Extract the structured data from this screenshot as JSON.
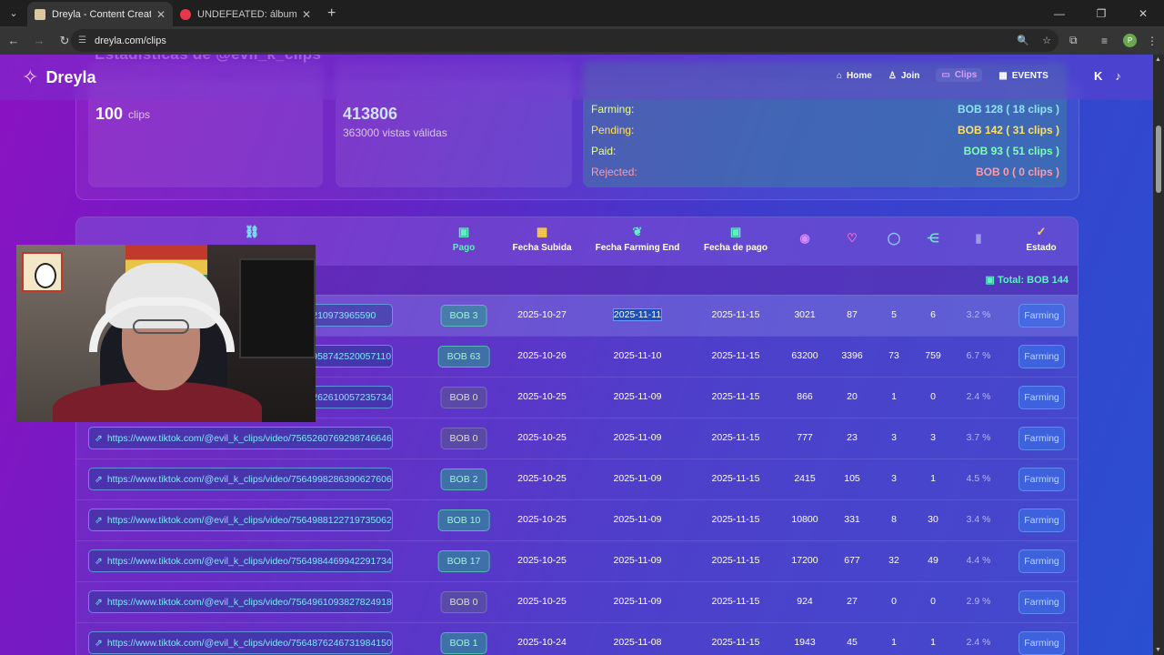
{
  "browser": {
    "tabs": [
      {
        "title": "Dreyla - Content Creator & Stre",
        "active": true
      },
      {
        "title": "UNDEFEATED: álbum de XG",
        "active": false
      }
    ],
    "url": "dreyla.com/clips",
    "profile_initial": "P"
  },
  "site": {
    "brand": "Dreyla",
    "ghost_title": "Estadísticas de @evil_k_clips",
    "nav": [
      "Home",
      "Join",
      "Clips",
      "EVENTS"
    ],
    "current": "Clips"
  },
  "stats": {
    "clips_value": "100",
    "clips_unit": "clips",
    "views_value": "413806",
    "views_sub": "363000 vistas válidas",
    "payments": [
      {
        "label": "Farming:",
        "value": "BOB 128 ( 18 clips )",
        "color": "#8fe3ff"
      },
      {
        "label": "Pending:",
        "value": "BOB 142 ( 31 clips )",
        "color": "#ffe066"
      },
      {
        "label": "Paid:",
        "value": "BOB 93 ( 51 clips )",
        "color": "#7dffb5"
      },
      {
        "label": "Rejected:",
        "value": "BOB 0 ( 0 clips )",
        "color": "#ff9aa8"
      }
    ]
  },
  "table": {
    "headers": {
      "pago": "Pago",
      "subida": "Fecha Subida",
      "farming_end": "Fecha Farming End",
      "fecha_pago": "Fecha de pago",
      "estado": "Estado"
    },
    "total": "Total: BOB 144",
    "rows": [
      {
        "link": "https://www.tiktok.com/@evil_k_clips/video/7565210973965590",
        "pago": "BOB 3",
        "paid": true,
        "subida": "2025-10-27",
        "fend": "2025-11-11",
        "fpago": "2025-11-15",
        "views": "3021",
        "likes": "87",
        "comments": "5",
        "shares": "6",
        "pct": "3.2 %",
        "estado": "Farming"
      },
      {
        "link": "https://www.tiktok.com/@evil_k_clips/video/7564958742520057110",
        "pago": "BOB 63",
        "paid": true,
        "subida": "2025-10-26",
        "fend": "2025-11-10",
        "fpago": "2025-11-15",
        "views": "63200",
        "likes": "3396",
        "comments": "73",
        "shares": "759",
        "pct": "6.7 %",
        "estado": "Farming"
      },
      {
        "link": "https://www.tiktok.com/@evil_k_clips/video/7565262610057235734",
        "pago": "BOB 0",
        "paid": false,
        "subida": "2025-10-25",
        "fend": "2025-11-09",
        "fpago": "2025-11-15",
        "views": "866",
        "likes": "20",
        "comments": "1",
        "shares": "0",
        "pct": "2.4 %",
        "estado": "Farming"
      },
      {
        "link": "https://www.tiktok.com/@evil_k_clips/video/7565260769298746646",
        "pago": "BOB 0",
        "paid": false,
        "subida": "2025-10-25",
        "fend": "2025-11-09",
        "fpago": "2025-11-15",
        "views": "777",
        "likes": "23",
        "comments": "3",
        "shares": "3",
        "pct": "3.7 %",
        "estado": "Farming"
      },
      {
        "link": "https://www.tiktok.com/@evil_k_clips/video/7564998286390627606",
        "pago": "BOB 2",
        "paid": true,
        "subida": "2025-10-25",
        "fend": "2025-11-09",
        "fpago": "2025-11-15",
        "views": "2415",
        "likes": "105",
        "comments": "3",
        "shares": "1",
        "pct": "4.5 %",
        "estado": "Farming"
      },
      {
        "link": "https://www.tiktok.com/@evil_k_clips/video/7564988122719735062",
        "pago": "BOB 10",
        "paid": true,
        "subida": "2025-10-25",
        "fend": "2025-11-09",
        "fpago": "2025-11-15",
        "views": "10800",
        "likes": "331",
        "comments": "8",
        "shares": "30",
        "pct": "3.4 %",
        "estado": "Farming"
      },
      {
        "link": "https://www.tiktok.com/@evil_k_clips/video/7564984469942291734",
        "pago": "BOB 17",
        "paid": true,
        "subida": "2025-10-25",
        "fend": "2025-11-09",
        "fpago": "2025-11-15",
        "views": "17200",
        "likes": "677",
        "comments": "32",
        "shares": "49",
        "pct": "4.4 %",
        "estado": "Farming"
      },
      {
        "link": "https://www.tiktok.com/@evil_k_clips/video/7564961093827824918",
        "pago": "BOB 0",
        "paid": false,
        "subida": "2025-10-25",
        "fend": "2025-11-09",
        "fpago": "2025-11-15",
        "views": "924",
        "likes": "27",
        "comments": "0",
        "shares": "0",
        "pct": "2.9 %",
        "estado": "Farming"
      },
      {
        "link": "https://www.tiktok.com/@evil_k_clips/video/7564876246731984150",
        "pago": "BOB 1",
        "paid": true,
        "subida": "2025-10-24",
        "fend": "2025-11-08",
        "fpago": "2025-11-15",
        "views": "1943",
        "likes": "45",
        "comments": "1",
        "shares": "1",
        "pct": "2.4 %",
        "estado": "Farming"
      }
    ]
  }
}
